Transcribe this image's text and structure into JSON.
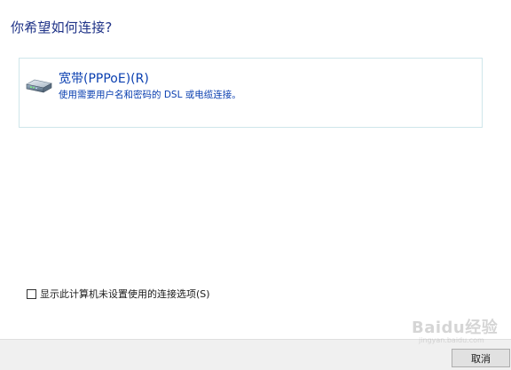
{
  "dialog": {
    "heading": "你希望如何连接?"
  },
  "options": [
    {
      "icon": "broadband-modem-icon",
      "title": "宽带(PPPoE)(R)",
      "description": "使用需要用户名和密码的 DSL 或电缆连接。"
    }
  ],
  "checkbox": {
    "label": "显示此计算机未设置使用的连接选项(S)",
    "checked": false
  },
  "footer": {
    "cancel_label": "取消"
  },
  "watermark": {
    "main": "Baidu经验",
    "sub": "jingyan.baidu.com"
  },
  "colors": {
    "heading": "#1e3287",
    "link_text": "#0a3fb0",
    "card_border": "#cfe6ea",
    "footer_bg": "#f0f0f0"
  }
}
